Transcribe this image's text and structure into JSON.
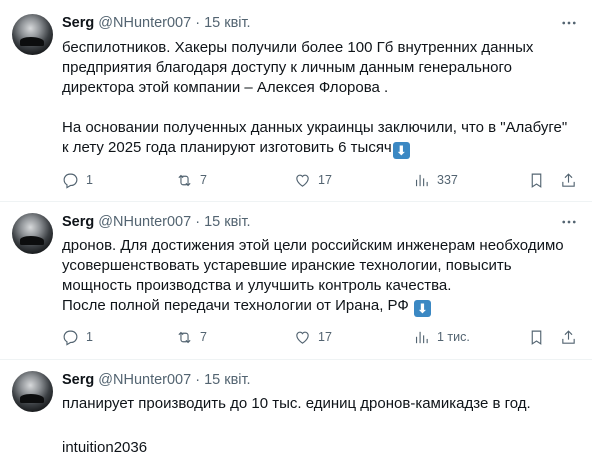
{
  "tweets": [
    {
      "author": "Serg",
      "handle": "@NHunter007",
      "separator": "·",
      "date": "15 квіт.",
      "lines": [
        "беспилотников. Хакеры получили более 100 Гб внутренних данных",
        "предприятия благодаря доступу к личным данным генерального",
        "директора этой компании – Алексея Флорова .",
        "",
        "На основании полученных данных украинцы заключили, что в \"Алабуге\"",
        "к лету 2025 года планируют изготовить 6 тысяч"
      ],
      "replies": "1",
      "retweets": "7",
      "likes": "17",
      "views": "337"
    },
    {
      "author": "Serg",
      "handle": "@NHunter007",
      "separator": "·",
      "date": "15 квіт.",
      "lines": [
        "дронов. Для достижения этой цели российским инженерам необходимо",
        "усовершенствовать устаревшие иранские технологии, повысить",
        "мощность производства и улучшить контроль качества.",
        "После полной передачи технологии от Ирана, РФ"
      ],
      "replies": "1",
      "retweets": "7",
      "likes": "17",
      "views": "1 тис."
    },
    {
      "author": "Serg",
      "handle": "@NHunter007",
      "separator": "·",
      "date": "15 квіт.",
      "lines": [
        "планирует производить до 10 тыс. единиц дронов-камикадзе в год.",
        "",
        "intuition2036"
      ]
    }
  ],
  "icons": {
    "emoji_down": "⬇",
    "accent": "#3b88c3",
    "muted": "#536471"
  }
}
